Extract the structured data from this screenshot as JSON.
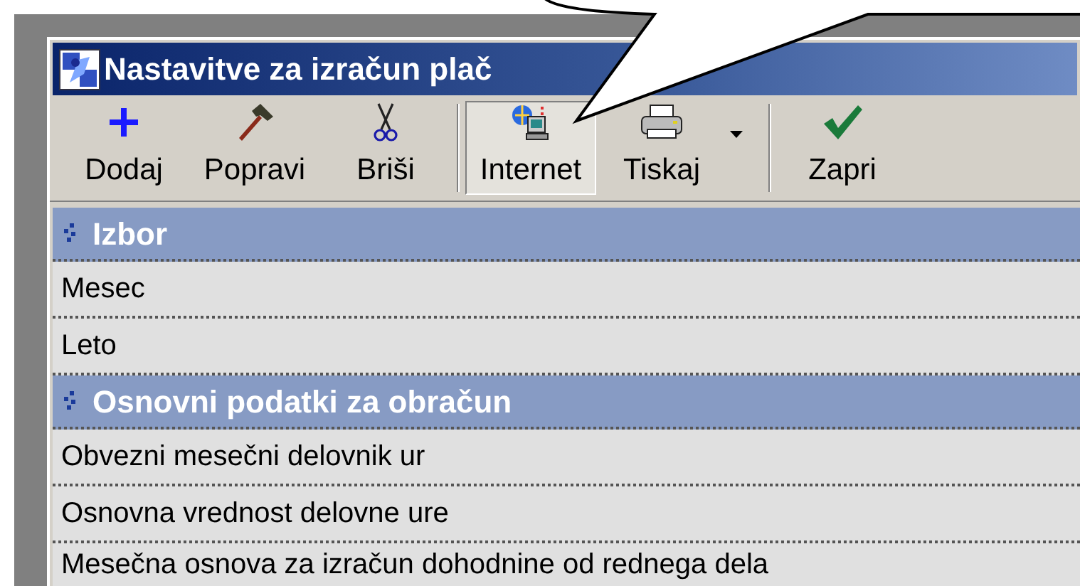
{
  "window": {
    "title": "Nastavitve za izračun plač"
  },
  "toolbar": {
    "groups": [
      [
        {
          "kind": "add",
          "label": "Dodaj",
          "pressed": false,
          "dropdown": false
        },
        {
          "kind": "edit",
          "label": "Popravi",
          "pressed": false,
          "dropdown": false
        },
        {
          "kind": "delete",
          "label": "Briši",
          "pressed": false,
          "dropdown": false
        }
      ],
      [
        {
          "kind": "internet",
          "label": "Internet",
          "pressed": true,
          "dropdown": false
        },
        {
          "kind": "print",
          "label": "Tiskaj",
          "pressed": false,
          "dropdown": true
        }
      ],
      [
        {
          "kind": "close",
          "label": "Zapri",
          "pressed": false,
          "dropdown": false
        }
      ]
    ]
  },
  "properties": [
    {
      "kind": "category",
      "label": "Izbor"
    },
    {
      "kind": "item",
      "label": "Mesec"
    },
    {
      "kind": "item",
      "label": "Leto"
    },
    {
      "kind": "category",
      "label": "Osnovni podatki za obračun"
    },
    {
      "kind": "item",
      "label": "Obvezni mesečni delovnik ur"
    },
    {
      "kind": "item",
      "label": "Osnovna vrednost delovne ure"
    },
    {
      "kind": "item",
      "label": "Mesečna osnova za izračun dohodnine od rednega dela"
    }
  ]
}
